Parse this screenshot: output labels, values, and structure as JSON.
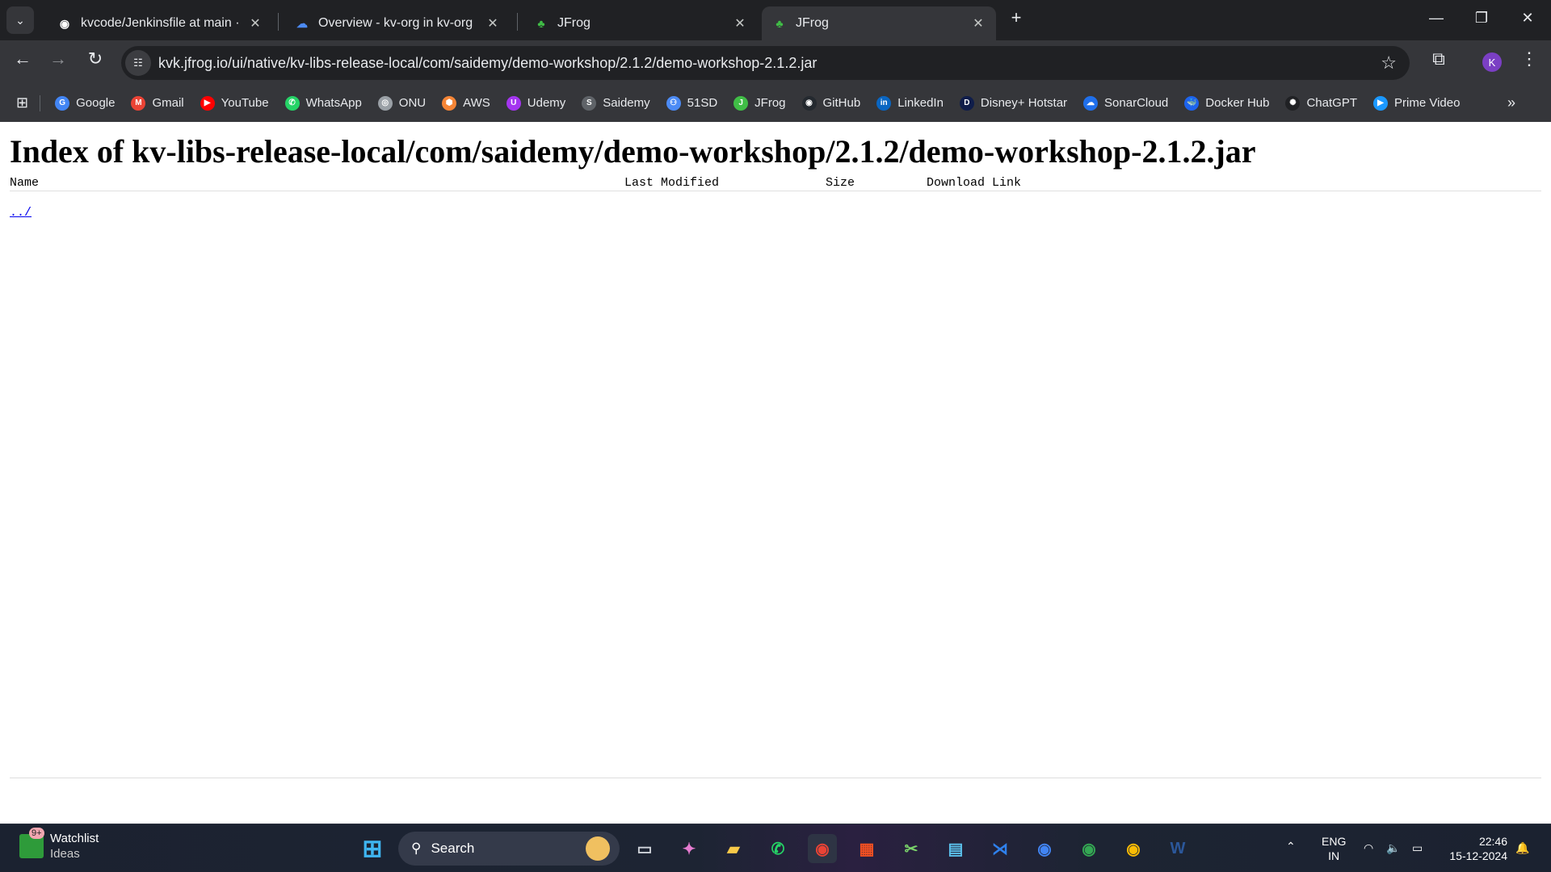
{
  "browser": {
    "tabs": [
      {
        "title": "kvcode/Jenkinsfile at main · Kar",
        "icon": "github-icon",
        "active": false
      },
      {
        "title": "Overview - kv-org in kv-org Sor",
        "icon": "sonarcloud-icon",
        "active": false
      },
      {
        "title": "JFrog",
        "icon": "jfrog-icon",
        "active": false
      },
      {
        "title": "JFrog",
        "icon": "jfrog-icon",
        "active": true
      }
    ],
    "new_tab": "+",
    "url": "kvk.jfrog.io/ui/native/kv-libs-release-local/com/saidemy/demo-workshop/2.1.2/demo-workshop-2.1.2.jar",
    "profile_initial": "K",
    "bookmarks": [
      {
        "label": "Google",
        "color": "#4285f4",
        "glyph": "G"
      },
      {
        "label": "Gmail",
        "color": "#ea4335",
        "glyph": "M"
      },
      {
        "label": "YouTube",
        "color": "#ff0000",
        "glyph": "▶"
      },
      {
        "label": "WhatsApp",
        "color": "#25d366",
        "glyph": "✆"
      },
      {
        "label": "ONU",
        "color": "#9aa0a6",
        "glyph": "◎"
      },
      {
        "label": "AWS",
        "color": "#f58536",
        "glyph": "⬢"
      },
      {
        "label": "Udemy",
        "color": "#a435f0",
        "glyph": "U"
      },
      {
        "label": "Saidemy",
        "color": "#5f6368",
        "glyph": "S"
      },
      {
        "label": "51SD",
        "color": "#4c8bf5",
        "glyph": "⚇"
      },
      {
        "label": "JFrog",
        "color": "#40be46",
        "glyph": "J"
      },
      {
        "label": "GitHub",
        "color": "#24292f",
        "glyph": "◉"
      },
      {
        "label": "LinkedIn",
        "color": "#0a66c2",
        "glyph": "in"
      },
      {
        "label": "Disney+ Hotstar",
        "color": "#0f1d4a",
        "glyph": "D"
      },
      {
        "label": "SonarCloud",
        "color": "#1f6feb",
        "glyph": "☁"
      },
      {
        "label": "Docker Hub",
        "color": "#1d63ed",
        "glyph": "🐳"
      },
      {
        "label": "ChatGPT",
        "color": "#202124",
        "glyph": "✺"
      },
      {
        "label": "Prime Video",
        "color": "#1a98ff",
        "glyph": "▶"
      }
    ],
    "more_bookmarks": "»"
  },
  "page": {
    "title": "Index of kv-libs-release-local/com/saidemy/demo-workshop/2.1.2/demo-workshop-2.1.2.jar",
    "columns": [
      "Name",
      "Last Modified",
      "Size",
      "Download Link"
    ],
    "parent_link": "../"
  },
  "taskbar": {
    "widget": {
      "title": "Watchlist",
      "subtitle": "Ideas",
      "badge": "9+"
    },
    "search_label": "Search",
    "apps": [
      {
        "name": "task-view",
        "glyph": "▭",
        "color": "#cfd3da"
      },
      {
        "name": "copilot",
        "glyph": "✦",
        "color": "#e57bd0"
      },
      {
        "name": "file-explorer",
        "glyph": "▰",
        "color": "#f7c948"
      },
      {
        "name": "whatsapp",
        "glyph": "✆",
        "color": "#25d366"
      },
      {
        "name": "chrome",
        "glyph": "◉",
        "color": "#ea4335",
        "active": true
      },
      {
        "name": "microsoft-store",
        "glyph": "▦",
        "color": "#f25022"
      },
      {
        "name": "snipping-tool",
        "glyph": "✂",
        "color": "#7ad36a"
      },
      {
        "name": "notepad",
        "glyph": "▤",
        "color": "#5bc0eb"
      },
      {
        "name": "vscode",
        "glyph": "⋊",
        "color": "#2f80ed"
      },
      {
        "name": "chrome-2",
        "glyph": "◉",
        "color": "#4285f4"
      },
      {
        "name": "chrome-3",
        "glyph": "◉",
        "color": "#34a853"
      },
      {
        "name": "chrome-4",
        "glyph": "◉",
        "color": "#fbbc05"
      },
      {
        "name": "word",
        "glyph": "W",
        "color": "#2b579a"
      }
    ],
    "lang": "ENG",
    "region": "IN",
    "time": "22:46",
    "date": "15-12-2024"
  }
}
